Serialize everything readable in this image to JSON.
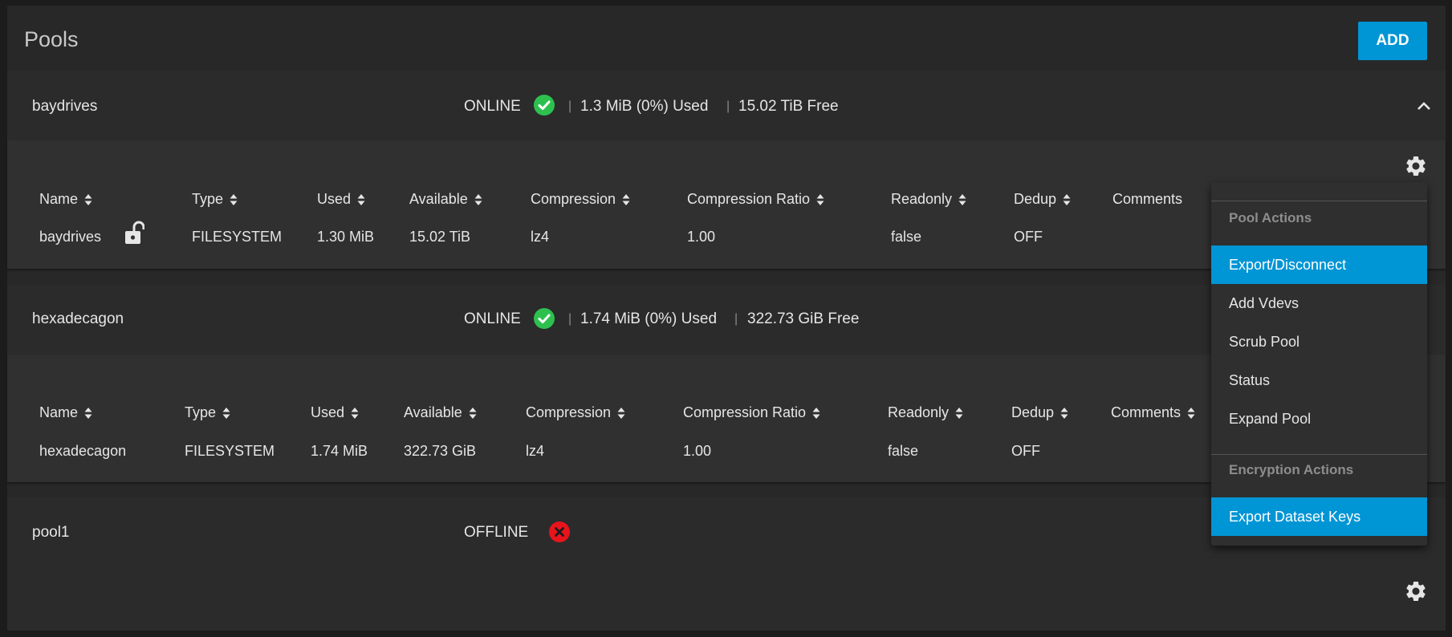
{
  "page": {
    "title": "Pools",
    "add_label": "ADD"
  },
  "pools": [
    {
      "name": "baydrives",
      "status": "ONLINE",
      "sep": "|",
      "used": "1.3 MiB (0%) Used",
      "free": "15.02 TiB Free",
      "columns": [
        "Name",
        "Type",
        "Used",
        "Available",
        "Compression",
        "Compression Ratio",
        "Readonly",
        "Dedup",
        "Comments"
      ],
      "row": {
        "name": "baydrives",
        "type": "FILESYSTEM",
        "used": "1.30 MiB",
        "available": "15.02 TiB",
        "compression": "lz4",
        "ratio": "1.00",
        "readonly": "false",
        "dedup": "OFF"
      }
    },
    {
      "name": "hexadecagon",
      "status": "ONLINE",
      "sep": "|",
      "used": "1.74 MiB (0%) Used",
      "free": "322.73 GiB Free",
      "columns": [
        "Name",
        "Type",
        "Used",
        "Available",
        "Compression",
        "Compression Ratio",
        "Readonly",
        "Dedup",
        "Comments"
      ],
      "row": {
        "name": "hexadecagon",
        "type": "FILESYSTEM",
        "used": "1.74 MiB",
        "available": "322.73 GiB",
        "compression": "lz4",
        "ratio": "1.00",
        "readonly": "false",
        "dedup": "OFF"
      }
    },
    {
      "name": "pool1",
      "status": "OFFLINE"
    }
  ],
  "menu": {
    "pool_actions_header": "Pool Actions",
    "pool_actions": [
      "Export/Disconnect",
      "Add Vdevs",
      "Scrub Pool",
      "Status",
      "Expand Pool"
    ],
    "encryption_header": "Encryption Actions",
    "encryption_actions": [
      "Export Dataset Keys"
    ]
  },
  "colors": {
    "accent": "#0095d5",
    "online": "#2ec04f",
    "offline": "#e8141c"
  },
  "icons": [
    "check-circle-icon",
    "error-circle-icon",
    "sort-icon",
    "unlock-icon",
    "gear-icon",
    "chevron-up-icon"
  ]
}
